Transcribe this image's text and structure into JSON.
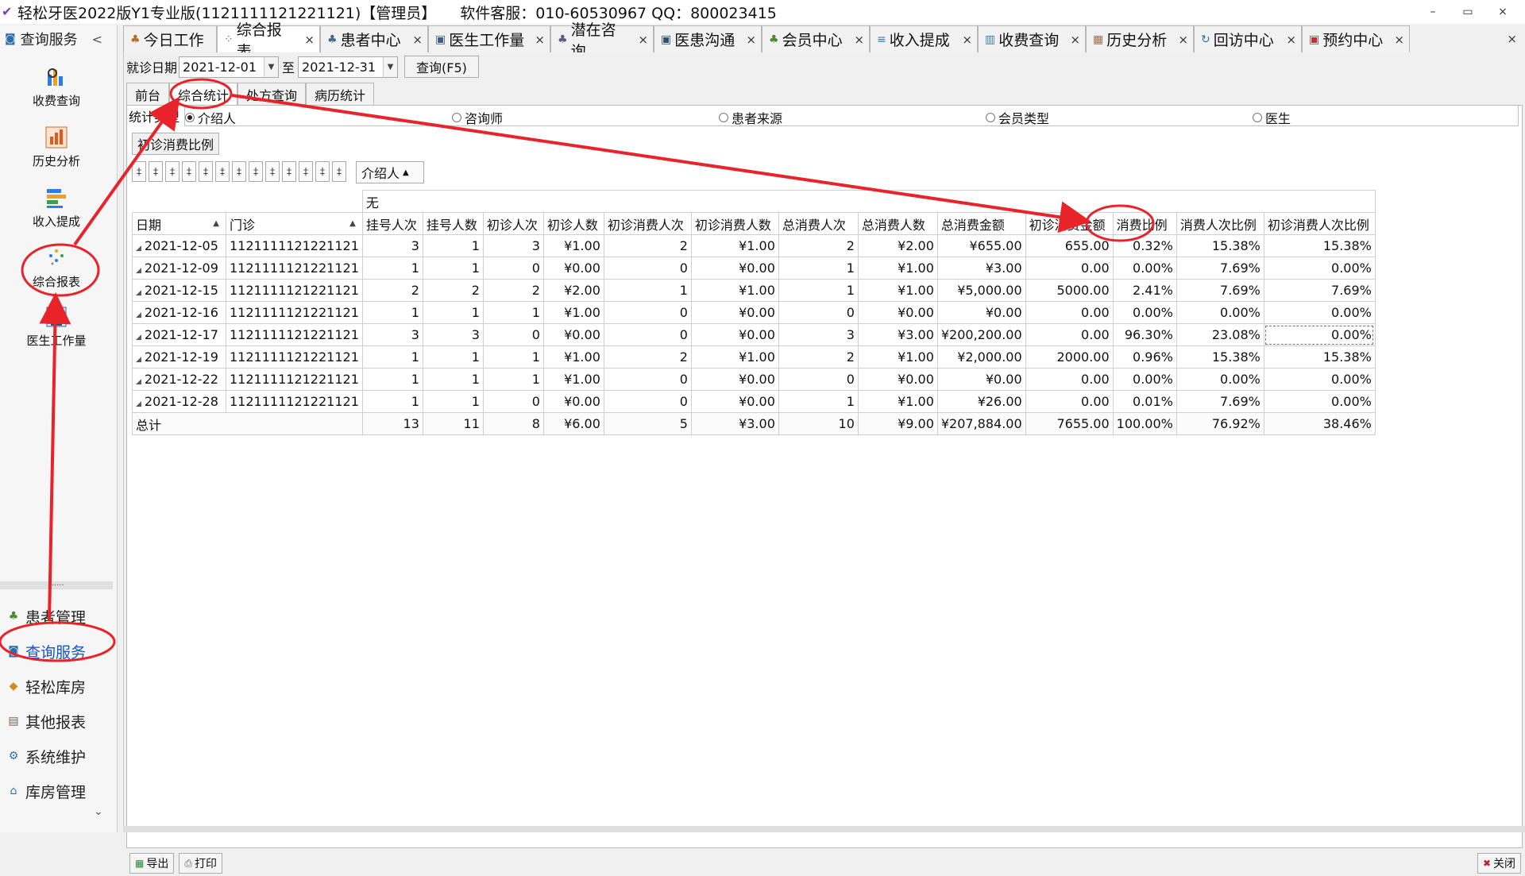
{
  "window": {
    "title": "轻松牙医2022版Y1专业版(1121111121221121)【管理员】",
    "support": "软件客服：010-60530967 QQ：800023415",
    "minimize": "–",
    "restore": "▭",
    "close": "×"
  },
  "sidebar": {
    "header": "查询服务",
    "collapse": "<",
    "tiles": [
      {
        "label": "收费查询"
      },
      {
        "label": "历史分析"
      },
      {
        "label": "收入提成"
      },
      {
        "label": "综合报表"
      },
      {
        "label": "医生工作量"
      }
    ],
    "dots": "......",
    "nav": [
      {
        "label": "患者管理"
      },
      {
        "label": "查询服务"
      },
      {
        "label": "轻松库房"
      },
      {
        "label": "其他报表"
      },
      {
        "label": "系统维护"
      },
      {
        "label": "库房管理"
      }
    ],
    "scroll_down": "⌄"
  },
  "tabs": [
    {
      "label": "今日工作"
    },
    {
      "label": "综合报表"
    },
    {
      "label": "患者中心"
    },
    {
      "label": "医生工作量"
    },
    {
      "label": "潜在咨询"
    },
    {
      "label": "医患沟通"
    },
    {
      "label": "会员中心"
    },
    {
      "label": "收入提成"
    },
    {
      "label": "收费查询"
    },
    {
      "label": "历史分析"
    },
    {
      "label": "回访中心"
    },
    {
      "label": "预约中心"
    }
  ],
  "tab_close": "×",
  "filter": {
    "date_label": "就诊日期",
    "from": "2021-12-01",
    "to_label": "至",
    "to": "2021-12-31",
    "query_button": "查询(F5)"
  },
  "subtabs": [
    {
      "label": "前台"
    },
    {
      "label": "综合统计"
    },
    {
      "label": "处方查询"
    },
    {
      "label": "病历统计"
    }
  ],
  "stat_type": {
    "label": "统计类型",
    "options": [
      {
        "label": "介绍人",
        "selected": true
      },
      {
        "label": "咨询师",
        "selected": false
      },
      {
        "label": "患者来源",
        "selected": false
      },
      {
        "label": "会员类型",
        "selected": false
      },
      {
        "label": "医生",
        "selected": false
      }
    ]
  },
  "ratio_button": "初诊消费比例",
  "group_field": "介绍人",
  "grid": {
    "group_value": "无",
    "row_headers": [
      "日期",
      "门诊"
    ],
    "columns": [
      "挂号人次",
      "挂号人数",
      "初诊人次",
      "初诊人数",
      "初诊消费人次",
      "初诊消费人数",
      "总消费人次",
      "总消费人数",
      "总消费金额",
      "初诊消费金额",
      "消费比例",
      "消费人次比例",
      "初诊消费人次比例"
    ],
    "rows": [
      {
        "date": "2021-12-05",
        "clinic": "1121111121221121",
        "v": [
          "3",
          "1",
          "3",
          "¥1.00",
          "2",
          "¥1.00",
          "2",
          "¥2.00",
          "¥655.00",
          "655.00",
          "0.32%",
          "15.38%",
          "15.38%"
        ]
      },
      {
        "date": "2021-12-09",
        "clinic": "1121111121221121",
        "v": [
          "1",
          "1",
          "0",
          "¥0.00",
          "0",
          "¥0.00",
          "1",
          "¥1.00",
          "¥3.00",
          "0.00",
          "0.00%",
          "7.69%",
          "0.00%"
        ]
      },
      {
        "date": "2021-12-15",
        "clinic": "1121111121221121",
        "v": [
          "2",
          "2",
          "2",
          "¥2.00",
          "1",
          "¥1.00",
          "1",
          "¥1.00",
          "¥5,000.00",
          "5000.00",
          "2.41%",
          "7.69%",
          "7.69%"
        ]
      },
      {
        "date": "2021-12-16",
        "clinic": "1121111121221121",
        "v": [
          "1",
          "1",
          "1",
          "¥1.00",
          "0",
          "¥0.00",
          "0",
          "¥0.00",
          "¥0.00",
          "0.00",
          "0.00%",
          "0.00%",
          "0.00%"
        ]
      },
      {
        "date": "2021-12-17",
        "clinic": "1121111121221121",
        "v": [
          "3",
          "3",
          "0",
          "¥0.00",
          "0",
          "¥0.00",
          "3",
          "¥3.00",
          "¥200,200.00",
          "0.00",
          "96.30%",
          "23.08%",
          "0.00%"
        ]
      },
      {
        "date": "2021-12-19",
        "clinic": "1121111121221121",
        "v": [
          "1",
          "1",
          "1",
          "¥1.00",
          "2",
          "¥1.00",
          "2",
          "¥1.00",
          "¥2,000.00",
          "2000.00",
          "0.96%",
          "15.38%",
          "15.38%"
        ]
      },
      {
        "date": "2021-12-22",
        "clinic": "1121111121221121",
        "v": [
          "1",
          "1",
          "1",
          "¥1.00",
          "0",
          "¥0.00",
          "0",
          "¥0.00",
          "¥0.00",
          "0.00",
          "0.00%",
          "0.00%",
          "0.00%"
        ]
      },
      {
        "date": "2021-12-28",
        "clinic": "1121111121221121",
        "v": [
          "1",
          "1",
          "0",
          "¥0.00",
          "0",
          "¥0.00",
          "1",
          "¥1.00",
          "¥26.00",
          "0.00",
          "0.01%",
          "7.69%",
          "0.00%"
        ]
      }
    ],
    "total": {
      "label": "总计",
      "v": [
        "13",
        "11",
        "8",
        "¥6.00",
        "5",
        "¥3.00",
        "10",
        "¥9.00",
        "¥207,884.00",
        "7655.00",
        "100.00%",
        "76.92%",
        "38.46%"
      ]
    }
  },
  "bottom": {
    "export": "导出",
    "print": "打印",
    "close": "关闭"
  },
  "colors": {
    "annotation": "#e8232a",
    "active_nav": "#1155cc"
  }
}
